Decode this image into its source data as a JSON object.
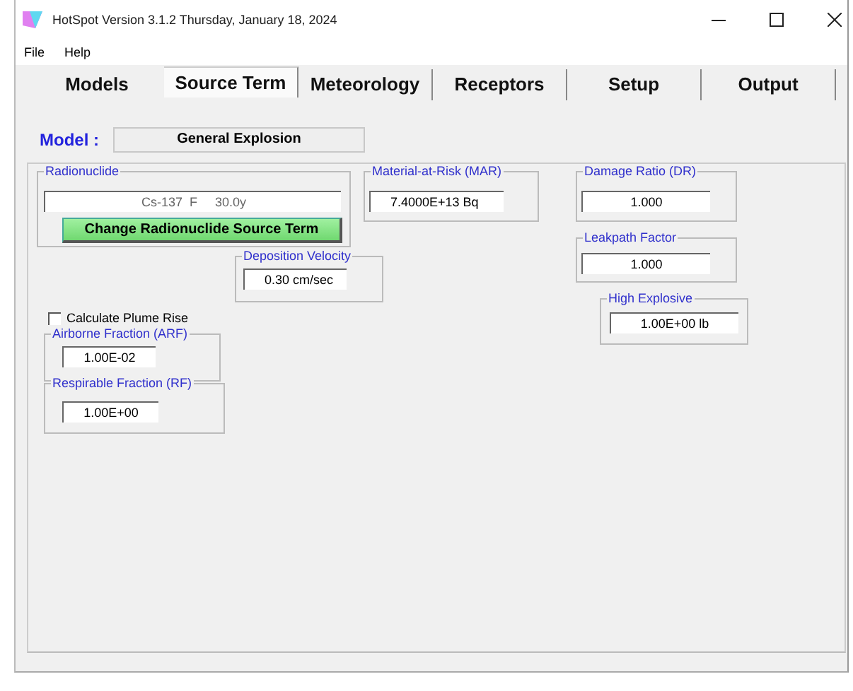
{
  "window": {
    "title": "HotSpot Version 3.1.2 Thursday, January 18, 2024"
  },
  "menu": [
    "File",
    "Help"
  ],
  "tabs": [
    {
      "label": "Models",
      "selected": false
    },
    {
      "label": "Source Term",
      "selected": true
    },
    {
      "label": "Meteorology",
      "selected": false
    },
    {
      "label": "Receptors",
      "selected": false
    },
    {
      "label": "Setup",
      "selected": false
    },
    {
      "label": "Output",
      "selected": false
    }
  ],
  "model": {
    "label": "Model :",
    "value": "General Explosion"
  },
  "radionuclide": {
    "title": "Radionuclide",
    "value": "Cs-137  F     30.0y",
    "button": "Change Radionuclide Source Term"
  },
  "groups": [
    {
      "title": "Material-at-Risk (MAR)",
      "value": "7.4000E+13 Bq"
    },
    {
      "title": "Damage Ratio (DR)",
      "value": "1.000"
    },
    {
      "title": "Leakpath Factor",
      "value": "1.000"
    },
    {
      "title": "High Explosive",
      "value": "1.00E+00 lb"
    },
    {
      "title": "Deposition Velocity",
      "value": "0.30 cm/sec"
    },
    {
      "title": "Airborne Fraction (ARF)",
      "value": "1.00E-02"
    },
    {
      "title": "Respirable Fraction (RF)",
      "value": "1.00E+00"
    }
  ],
  "plume_rise": {
    "label": "Calculate Plume Rise",
    "checked": false
  }
}
